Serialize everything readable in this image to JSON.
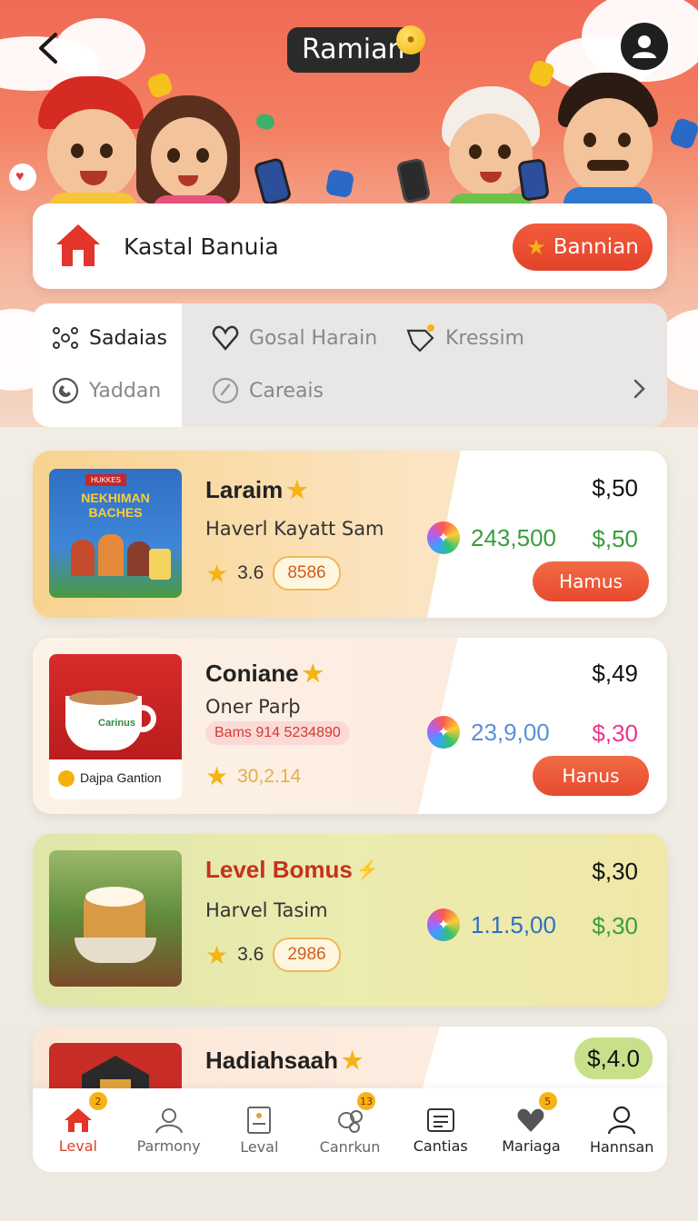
{
  "header": {
    "title": "Ramian",
    "back_icon": "chevron-left-icon",
    "profile_icon": "user-icon"
  },
  "home_card": {
    "icon": "home-icon",
    "title": "Kastal Banuia",
    "button_label": "Bannian",
    "button_icon": "star-icon"
  },
  "categories": {
    "items": [
      {
        "label": "Sadaias",
        "icon": "network-icon",
        "active": true
      },
      {
        "label": "Gosal Harain",
        "icon": "heart-icon",
        "active": false
      },
      {
        "label": "Kressim",
        "icon": "tag-icon",
        "active": false
      },
      {
        "label": "Yaddan",
        "icon": "phone-icon",
        "active": false
      },
      {
        "label": "Careais",
        "icon": "compass-icon",
        "active": false
      }
    ],
    "more_icon": "chevron-right-icon"
  },
  "offers": [
    {
      "title": "Laraim",
      "subtitle": "Haverl Kayatt Sam",
      "rating": "3.6",
      "tag": "8586",
      "price_top": "$,50",
      "mid_value": "243,500",
      "mid_price": "$,50",
      "cta": "Hamus",
      "thumb_text": "NEKHIMAN BACHES",
      "thumb_label": "HUKKES"
    },
    {
      "title": "Coniane",
      "subtitle": "Oner Parþ",
      "code": "Bams 914 5234890",
      "rating_value": "30,2.14",
      "price_top": "$,49",
      "mid_value": "23,9,00",
      "mid_price": "$,30",
      "cta": "Hanus",
      "thumb_caption": "Dajpa Gantion",
      "thumb_brand": "Carinus"
    },
    {
      "title": "Level Bomus",
      "subtitle": "Harvel Tasim",
      "rating": "3.6",
      "tag": "2986",
      "price_top": "$,30",
      "mid_value": "1.1.5,00",
      "mid_price": "$,30"
    },
    {
      "title": "Hadiahsaah",
      "price_top": "$,4.0"
    }
  ],
  "bottom_nav": [
    {
      "label": "Leval",
      "icon": "home-icon",
      "badge": "2",
      "active": true
    },
    {
      "label": "Parmony",
      "icon": "user-icon",
      "badge": "",
      "active": false
    },
    {
      "label": "Leval",
      "icon": "document-icon",
      "badge": "",
      "active": false
    },
    {
      "label": "Canrkun",
      "icon": "gear-icon",
      "badge": "13",
      "active": false
    },
    {
      "label": "Cantias",
      "icon": "list-icon",
      "badge": "",
      "active": false
    },
    {
      "label": "Mariaga",
      "icon": "heart-icon",
      "badge": "5",
      "active": false
    },
    {
      "label": "Hannsan",
      "icon": "person-icon",
      "badge": "",
      "active": false
    }
  ],
  "colors": {
    "accent": "#e64a2e",
    "star": "#f5b316",
    "green": "#3b9c3e",
    "blue": "#4a7fd4",
    "pink": "#e8388b"
  }
}
